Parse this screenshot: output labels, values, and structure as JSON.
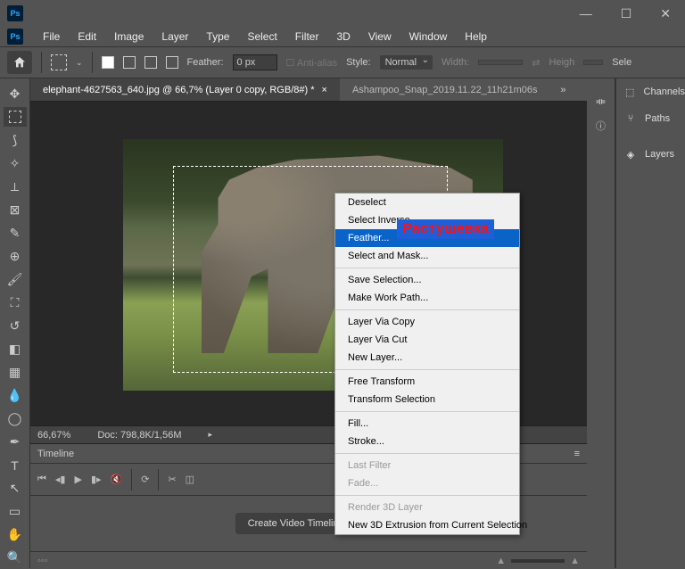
{
  "window": {
    "logo": "Ps"
  },
  "menubar": [
    "File",
    "Edit",
    "Image",
    "Layer",
    "Type",
    "Select",
    "Filter",
    "3D",
    "View",
    "Window",
    "Help"
  ],
  "options": {
    "feather_label": "Feather:",
    "feather_value": "0 px",
    "antialias_label": "Anti-alias",
    "style_label": "Style:",
    "style_value": "Normal",
    "width_label": "Width:",
    "height_label": "Heigh",
    "select_label": "Sele"
  },
  "tabs": [
    "elephant-4627563_640.jpg @ 66,7% (Layer 0 copy, RGB/8#) *",
    "Ashampoo_Snap_2019.11.22_11h21m06s"
  ],
  "status": {
    "zoom": "66,67%",
    "doc": "Doc: 798,8K/1,56M"
  },
  "timeline": {
    "title": "Timeline",
    "create": "Create Video Timeline"
  },
  "right_panels": [
    {
      "icon": "⬚",
      "label": "Channels"
    },
    {
      "icon": "⑂",
      "label": "Paths"
    },
    {
      "icon": "◈",
      "label": "Layers"
    }
  ],
  "context_menu": {
    "groups": [
      [
        "Deselect",
        "Select Inverse",
        "Feather...",
        "Select and Mask..."
      ],
      [
        "Save Selection...",
        "Make Work Path..."
      ],
      [
        "Layer Via Copy",
        "Layer Via Cut",
        "New Layer..."
      ],
      [
        "Free Transform",
        "Transform Selection"
      ],
      [
        "Fill...",
        "Stroke..."
      ],
      [
        "Last Filter",
        "Fade..."
      ],
      [
        "Render 3D Layer",
        "New 3D Extrusion from Current Selection"
      ]
    ],
    "highlight": "Feather...",
    "disabled": [
      "Last Filter",
      "Fade...",
      "Render 3D Layer"
    ]
  },
  "annotation": "Растушевка"
}
